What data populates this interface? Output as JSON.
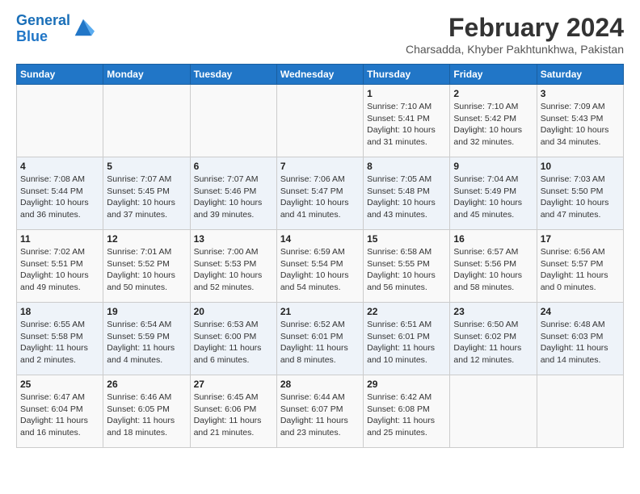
{
  "header": {
    "logo_line1": "General",
    "logo_line2": "Blue",
    "title": "February 2024",
    "subtitle": "Charsadda, Khyber Pakhtunkhwa, Pakistan"
  },
  "columns": [
    "Sunday",
    "Monday",
    "Tuesday",
    "Wednesday",
    "Thursday",
    "Friday",
    "Saturday"
  ],
  "weeks": [
    [
      {
        "day": "",
        "info": ""
      },
      {
        "day": "",
        "info": ""
      },
      {
        "day": "",
        "info": ""
      },
      {
        "day": "",
        "info": ""
      },
      {
        "day": "1",
        "info": "Sunrise: 7:10 AM\nSunset: 5:41 PM\nDaylight: 10 hours\nand 31 minutes."
      },
      {
        "day": "2",
        "info": "Sunrise: 7:10 AM\nSunset: 5:42 PM\nDaylight: 10 hours\nand 32 minutes."
      },
      {
        "day": "3",
        "info": "Sunrise: 7:09 AM\nSunset: 5:43 PM\nDaylight: 10 hours\nand 34 minutes."
      }
    ],
    [
      {
        "day": "4",
        "info": "Sunrise: 7:08 AM\nSunset: 5:44 PM\nDaylight: 10 hours\nand 36 minutes."
      },
      {
        "day": "5",
        "info": "Sunrise: 7:07 AM\nSunset: 5:45 PM\nDaylight: 10 hours\nand 37 minutes."
      },
      {
        "day": "6",
        "info": "Sunrise: 7:07 AM\nSunset: 5:46 PM\nDaylight: 10 hours\nand 39 minutes."
      },
      {
        "day": "7",
        "info": "Sunrise: 7:06 AM\nSunset: 5:47 PM\nDaylight: 10 hours\nand 41 minutes."
      },
      {
        "day": "8",
        "info": "Sunrise: 7:05 AM\nSunset: 5:48 PM\nDaylight: 10 hours\nand 43 minutes."
      },
      {
        "day": "9",
        "info": "Sunrise: 7:04 AM\nSunset: 5:49 PM\nDaylight: 10 hours\nand 45 minutes."
      },
      {
        "day": "10",
        "info": "Sunrise: 7:03 AM\nSunset: 5:50 PM\nDaylight: 10 hours\nand 47 minutes."
      }
    ],
    [
      {
        "day": "11",
        "info": "Sunrise: 7:02 AM\nSunset: 5:51 PM\nDaylight: 10 hours\nand 49 minutes."
      },
      {
        "day": "12",
        "info": "Sunrise: 7:01 AM\nSunset: 5:52 PM\nDaylight: 10 hours\nand 50 minutes."
      },
      {
        "day": "13",
        "info": "Sunrise: 7:00 AM\nSunset: 5:53 PM\nDaylight: 10 hours\nand 52 minutes."
      },
      {
        "day": "14",
        "info": "Sunrise: 6:59 AM\nSunset: 5:54 PM\nDaylight: 10 hours\nand 54 minutes."
      },
      {
        "day": "15",
        "info": "Sunrise: 6:58 AM\nSunset: 5:55 PM\nDaylight: 10 hours\nand 56 minutes."
      },
      {
        "day": "16",
        "info": "Sunrise: 6:57 AM\nSunset: 5:56 PM\nDaylight: 10 hours\nand 58 minutes."
      },
      {
        "day": "17",
        "info": "Sunrise: 6:56 AM\nSunset: 5:57 PM\nDaylight: 11 hours\nand 0 minutes."
      }
    ],
    [
      {
        "day": "18",
        "info": "Sunrise: 6:55 AM\nSunset: 5:58 PM\nDaylight: 11 hours\nand 2 minutes."
      },
      {
        "day": "19",
        "info": "Sunrise: 6:54 AM\nSunset: 5:59 PM\nDaylight: 11 hours\nand 4 minutes."
      },
      {
        "day": "20",
        "info": "Sunrise: 6:53 AM\nSunset: 6:00 PM\nDaylight: 11 hours\nand 6 minutes."
      },
      {
        "day": "21",
        "info": "Sunrise: 6:52 AM\nSunset: 6:01 PM\nDaylight: 11 hours\nand 8 minutes."
      },
      {
        "day": "22",
        "info": "Sunrise: 6:51 AM\nSunset: 6:01 PM\nDaylight: 11 hours\nand 10 minutes."
      },
      {
        "day": "23",
        "info": "Sunrise: 6:50 AM\nSunset: 6:02 PM\nDaylight: 11 hours\nand 12 minutes."
      },
      {
        "day": "24",
        "info": "Sunrise: 6:48 AM\nSunset: 6:03 PM\nDaylight: 11 hours\nand 14 minutes."
      }
    ],
    [
      {
        "day": "25",
        "info": "Sunrise: 6:47 AM\nSunset: 6:04 PM\nDaylight: 11 hours\nand 16 minutes."
      },
      {
        "day": "26",
        "info": "Sunrise: 6:46 AM\nSunset: 6:05 PM\nDaylight: 11 hours\nand 18 minutes."
      },
      {
        "day": "27",
        "info": "Sunrise: 6:45 AM\nSunset: 6:06 PM\nDaylight: 11 hours\nand 21 minutes."
      },
      {
        "day": "28",
        "info": "Sunrise: 6:44 AM\nSunset: 6:07 PM\nDaylight: 11 hours\nand 23 minutes."
      },
      {
        "day": "29",
        "info": "Sunrise: 6:42 AM\nSunset: 6:08 PM\nDaylight: 11 hours\nand 25 minutes."
      },
      {
        "day": "",
        "info": ""
      },
      {
        "day": "",
        "info": ""
      }
    ]
  ]
}
